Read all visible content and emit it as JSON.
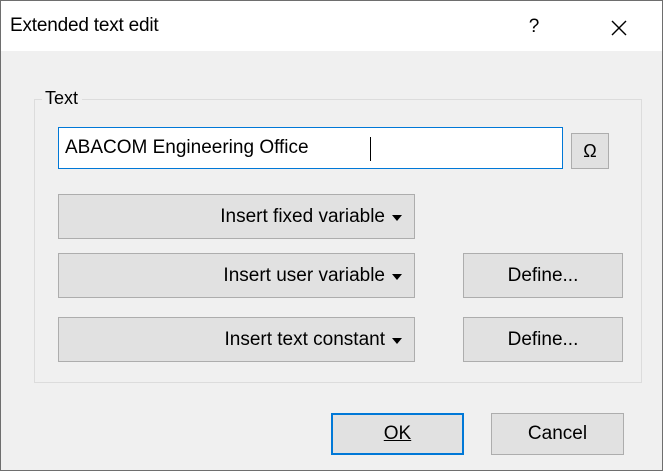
{
  "window": {
    "title": "Extended text edit",
    "help_label": "?",
    "close_icon": "close-icon"
  },
  "group": {
    "caption": "Text"
  },
  "text_field": {
    "value": "ABACOM Engineering Office"
  },
  "omega_button": {
    "label": "Ω",
    "icon": "omega-icon"
  },
  "buttons": {
    "insert_fixed_variable": "Insert fixed variable",
    "insert_user_variable": "Insert user variable",
    "insert_text_constant": "Insert text constant",
    "define_user": "Define...",
    "define_constant": "Define...",
    "ok_label": "OK",
    "cancel_label": "Cancel"
  },
  "colors": {
    "accent": "#0078d7",
    "dialog_background": "#f0f0f0",
    "button_face": "#e1e1e1"
  }
}
